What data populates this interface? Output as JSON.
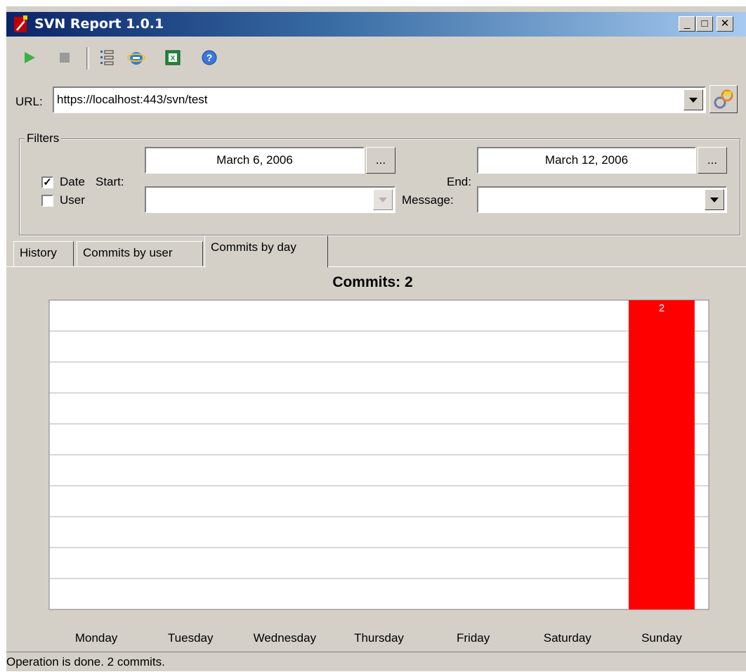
{
  "window": {
    "title": "SVN Report 1.0.1"
  },
  "toolbar": {
    "items": [
      {
        "icon": "play-icon"
      },
      {
        "icon": "stop-icon"
      },
      {
        "icon": "list-icon"
      },
      {
        "icon": "internet-explorer-icon"
      },
      {
        "icon": "excel-icon"
      },
      {
        "icon": "help-icon"
      }
    ]
  },
  "url": {
    "label": "URL:",
    "value": "https://localhost:443/svn/test"
  },
  "filters": {
    "title": "Filters",
    "date_label": "Date",
    "date_checked": true,
    "start_label": "Start:",
    "start_value": "March 6, 2006",
    "end_label": "End:",
    "end_value": "March 12, 2006",
    "browse_label": "...",
    "user_label": "User",
    "user_checked": false,
    "user_value": "",
    "message_label": "Message:",
    "message_value": ""
  },
  "tabs": [
    {
      "label": "History",
      "active": false
    },
    {
      "label": "Commits by user",
      "active": false
    },
    {
      "label": "Commits by day",
      "active": true
    }
  ],
  "chart_data": {
    "type": "bar",
    "title": "Commits: 2",
    "categories": [
      "Monday",
      "Tuesday",
      "Wednesday",
      "Thursday",
      "Friday",
      "Saturday",
      "Sunday"
    ],
    "values": [
      0,
      0,
      0,
      0,
      0,
      0,
      2
    ],
    "ylim": [
      0,
      2
    ],
    "grid": true,
    "bar_color": "#ff0000",
    "data_labels": [
      "",
      "",
      "",
      "",
      "",
      "",
      "2"
    ]
  },
  "status": {
    "text": "Operation is done. 2 commits."
  }
}
